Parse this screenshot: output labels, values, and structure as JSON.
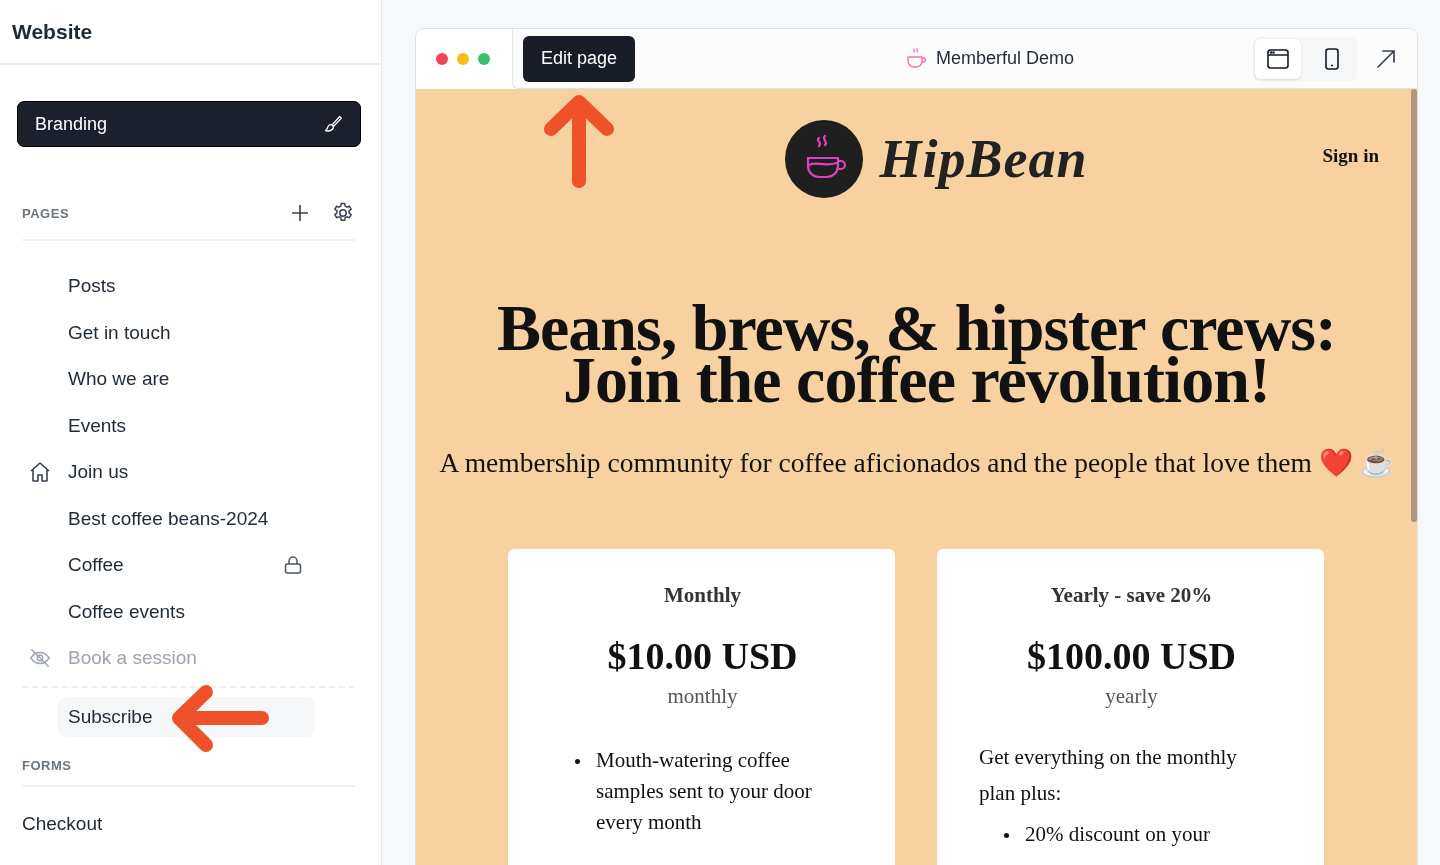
{
  "sidebar": {
    "title": "Website",
    "branding_button": "Branding",
    "pages_heading": "PAGES",
    "pages": [
      {
        "label": "Posts",
        "home": false,
        "locked": false,
        "hidden": false,
        "selected": false
      },
      {
        "label": "Get in touch",
        "home": false,
        "locked": false,
        "hidden": false,
        "selected": false
      },
      {
        "label": "Who we are",
        "home": false,
        "locked": false,
        "hidden": false,
        "selected": false
      },
      {
        "label": "Events",
        "home": false,
        "locked": false,
        "hidden": false,
        "selected": false
      },
      {
        "label": "Join us",
        "home": true,
        "locked": false,
        "hidden": false,
        "selected": false
      },
      {
        "label": "Best coffee beans-2024",
        "home": false,
        "locked": false,
        "hidden": false,
        "selected": false
      },
      {
        "label": "Coffee",
        "home": false,
        "locked": true,
        "hidden": false,
        "selected": false
      },
      {
        "label": "Coffee events",
        "home": false,
        "locked": false,
        "hidden": false,
        "selected": false
      },
      {
        "label": "Book a session",
        "home": false,
        "locked": false,
        "hidden": true,
        "selected": false
      }
    ],
    "special_pages": [
      {
        "label": "Subscribe",
        "selected": true
      }
    ],
    "forms_heading": "FORMS",
    "forms": [
      {
        "label": "Checkout"
      }
    ]
  },
  "preview": {
    "edit_button": "Edit page",
    "site_name": "Memberful Demo",
    "view_modes": [
      {
        "kind": "desktop",
        "selected": true
      },
      {
        "kind": "mobile",
        "selected": false
      }
    ],
    "site": {
      "logo_text": "HipBean",
      "sign_in": "Sign in",
      "headline_lines": [
        "Beans, brews, & hipster crews:",
        "Join the coffee revolution!"
      ],
      "tagline": "A membership community for coffee aficionados and the people that love them ❤️ ☕",
      "plans": [
        {
          "name": "Monthly",
          "price": "$10.00 USD",
          "period": "monthly",
          "features": [
            "Mouth-watering coffee samples sent to your door every month"
          ]
        },
        {
          "name": "Yearly - save 20%",
          "price": "$100.00 USD",
          "period": "yearly",
          "intro": "Get everything on the monthly plan plus:",
          "features": [
            "20% discount on your"
          ]
        }
      ]
    }
  }
}
